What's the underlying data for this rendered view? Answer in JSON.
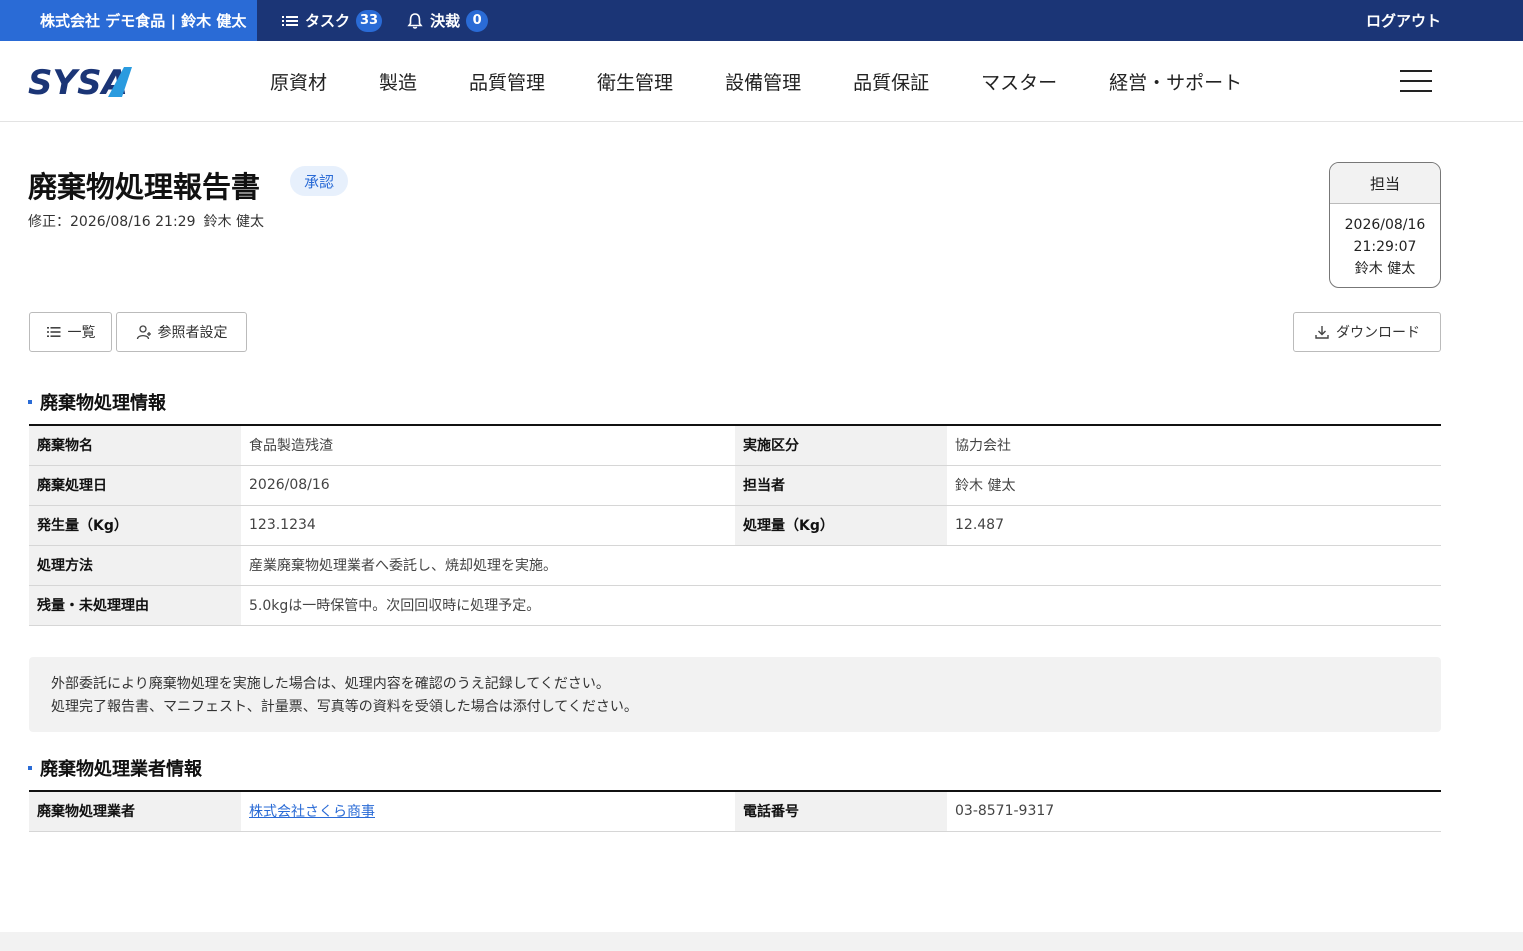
{
  "topbar": {
    "company_user": "株式会社 デモ食品 | 鈴木 健太",
    "tasks_label": "タスク",
    "tasks_count": "33",
    "approvals_label": "決裁",
    "approvals_count": "0",
    "logout_label": "ログアウト"
  },
  "nav": {
    "logo_text": "SYSA",
    "items": [
      "原資材",
      "製造",
      "品質管理",
      "衛生管理",
      "設備管理",
      "品質保証",
      "マスター",
      "経営・サポート"
    ]
  },
  "page": {
    "title": "廃棄物処理報告書",
    "status": "承認",
    "modified_label": "修正：2026/08/16 21:29",
    "modified_by": "鈴木 健太"
  },
  "stamp": {
    "header": "担当",
    "date": "2026/08/16",
    "time": "21:29:07",
    "name": "鈴木 健太"
  },
  "buttons": {
    "list": "一覧",
    "viewer_settings": "参照者設定",
    "download": "ダウンロード"
  },
  "sections": {
    "info_title": "廃棄物処理情報",
    "vendor_title": "廃棄物処理業者情報"
  },
  "info": {
    "waste_name_label": "廃棄物名",
    "waste_name": "食品製造残渣",
    "category_label": "実施区分",
    "category": "協力会社",
    "date_label": "廃棄処理日",
    "date": "2026/08/16",
    "person_label": "担当者",
    "person": "鈴木 健太",
    "generated_label": "発生量（Kg）",
    "generated": "123.1234",
    "processed_label": "処理量（Kg）",
    "processed": "12.487",
    "method_label": "処理方法",
    "method": "産業廃棄物処理業者へ委託し、焼却処理を実施。",
    "remainder_label": "残量・未処理理由",
    "remainder": "5.0kgは一時保管中。次回回収時に処理予定。"
  },
  "notice": {
    "line1": "外部委託により廃棄物処理を実施した場合は、処理内容を確認のうえ記録してください。",
    "line2": "処理完了報告書、マニフェスト、計量票、写真等の資料を受領した場合は添付してください。"
  },
  "vendor": {
    "vendor_label": "廃棄物処理業者",
    "vendor_name": "株式会社さくら商事",
    "phone_label": "電話番号",
    "phone": "03-8571-9317"
  },
  "colors": {
    "topbar": "#1b3576",
    "accent": "#2a6bd6",
    "badge_bg": "#e7f0fc"
  },
  "icons": [
    "list-icon",
    "bell-icon",
    "add-user-icon",
    "download-icon",
    "hamburger-icon"
  ]
}
